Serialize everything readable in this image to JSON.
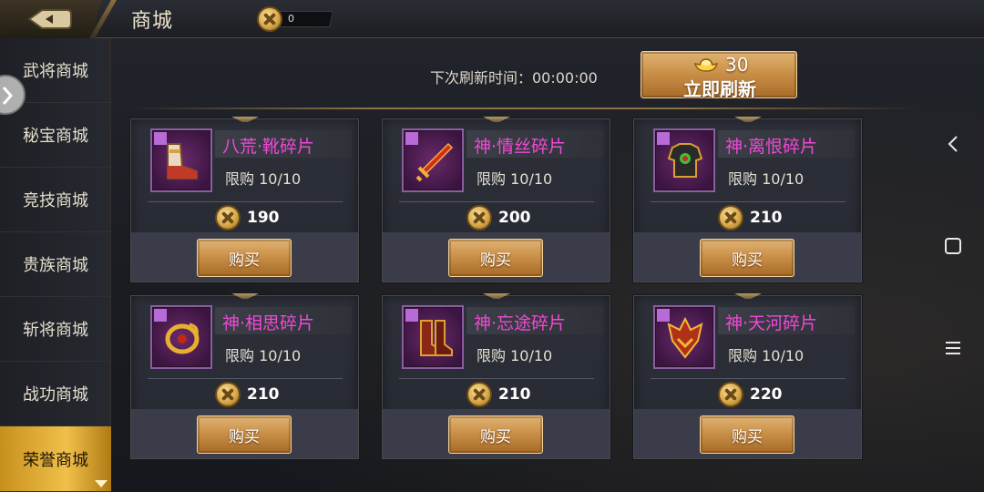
{
  "header": {
    "title": "商城",
    "currency_value": "0"
  },
  "sidebar": {
    "items": [
      {
        "label": "武将商城"
      },
      {
        "label": "秘宝商城"
      },
      {
        "label": "竞技商城"
      },
      {
        "label": "贵族商城"
      },
      {
        "label": "斩将商城"
      },
      {
        "label": "战功商城"
      },
      {
        "label": "荣誉商城",
        "active": true
      }
    ]
  },
  "refresh": {
    "label": "下次刷新时间：00:00:00",
    "cost": "30",
    "button_label": "立即刷新"
  },
  "items": [
    {
      "name": "八荒·靴碎片",
      "limit": "限购  10/10",
      "price": "190",
      "buy_label": "购买",
      "icon": "boots-icon"
    },
    {
      "name": "神·情丝碎片",
      "limit": "限购  10/10",
      "price": "200",
      "buy_label": "购买",
      "icon": "sword-icon"
    },
    {
      "name": "神·离恨碎片",
      "limit": "限购  10/10",
      "price": "210",
      "buy_label": "购买",
      "icon": "armor-icon"
    },
    {
      "name": "神·相思碎片",
      "limit": "限购  10/10",
      "price": "210",
      "buy_label": "购买",
      "icon": "dragon-ring-icon"
    },
    {
      "name": "神·忘途碎片",
      "limit": "限购  10/10",
      "price": "210",
      "buy_label": "购买",
      "icon": "war-boots-icon"
    },
    {
      "name": "神·天河碎片",
      "limit": "限购  10/10",
      "price": "220",
      "buy_label": "购买",
      "icon": "helmet-icon"
    }
  ],
  "colors": {
    "accent_gold": "#c88d45",
    "item_name": "#f049d6",
    "sidebar_active": "#f0c04a"
  }
}
